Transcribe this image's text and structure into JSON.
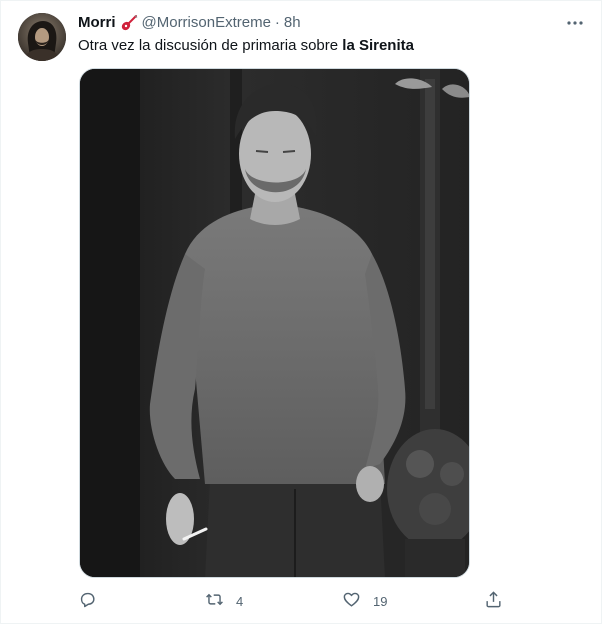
{
  "tweet": {
    "author_name": "Morri",
    "handle": "@MorrisonExtreme",
    "separator": "·",
    "time": "8h",
    "text_prefix": "Otra vez la discusión de primaria sobre ",
    "text_bold": "la Sirenita"
  },
  "actions": {
    "reply": {
      "icon": "reply-icon",
      "count": ""
    },
    "retweet": {
      "icon": "retweet-icon",
      "count": "4"
    },
    "like": {
      "icon": "heart-icon",
      "count": "19"
    },
    "share": {
      "icon": "share-icon",
      "count": ""
    }
  },
  "colors": {
    "text": "#0f1419",
    "secondary": "#536471",
    "border": "#cfd9de",
    "emoji_red": "#d0213b"
  }
}
